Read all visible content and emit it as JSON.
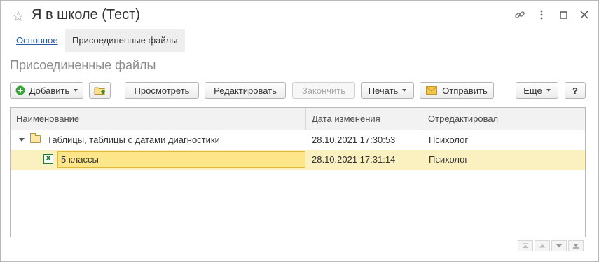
{
  "window": {
    "title": "Я в школе (Тест)",
    "icons": [
      "star-icon",
      "link-icon",
      "more-icon",
      "maximize-icon",
      "close-icon"
    ]
  },
  "tabs": {
    "main": "Основное",
    "files": "Присоединенные файлы"
  },
  "section_title": "Присоединенные файлы",
  "toolbar": {
    "add": "Добавить",
    "view": "Просмотреть",
    "edit": "Редактировать",
    "finish": "Закончить",
    "print": "Печать",
    "send": "Отправить",
    "more": "Еще",
    "help": "?"
  },
  "grid": {
    "columns": [
      "Наименование",
      "Дата изменения",
      "Отредактировал"
    ],
    "rows": [
      {
        "name": "Таблицы, таблицы с датами диагностики",
        "date": "28.10.2021 17:30:53",
        "editor": "Психолог",
        "kind": "folder",
        "expanded": true
      },
      {
        "name": "5 классы",
        "date": "28.10.2021 17:31:14",
        "editor": "Психолог",
        "kind": "excel-file",
        "selected": true
      }
    ]
  },
  "colors": {
    "link": "#2a5d9f",
    "selected_row": "#fbf0c0",
    "edit_highlight": "#fde58a",
    "excel_green": "#1e7e34",
    "add_green": "#3aa53a"
  }
}
